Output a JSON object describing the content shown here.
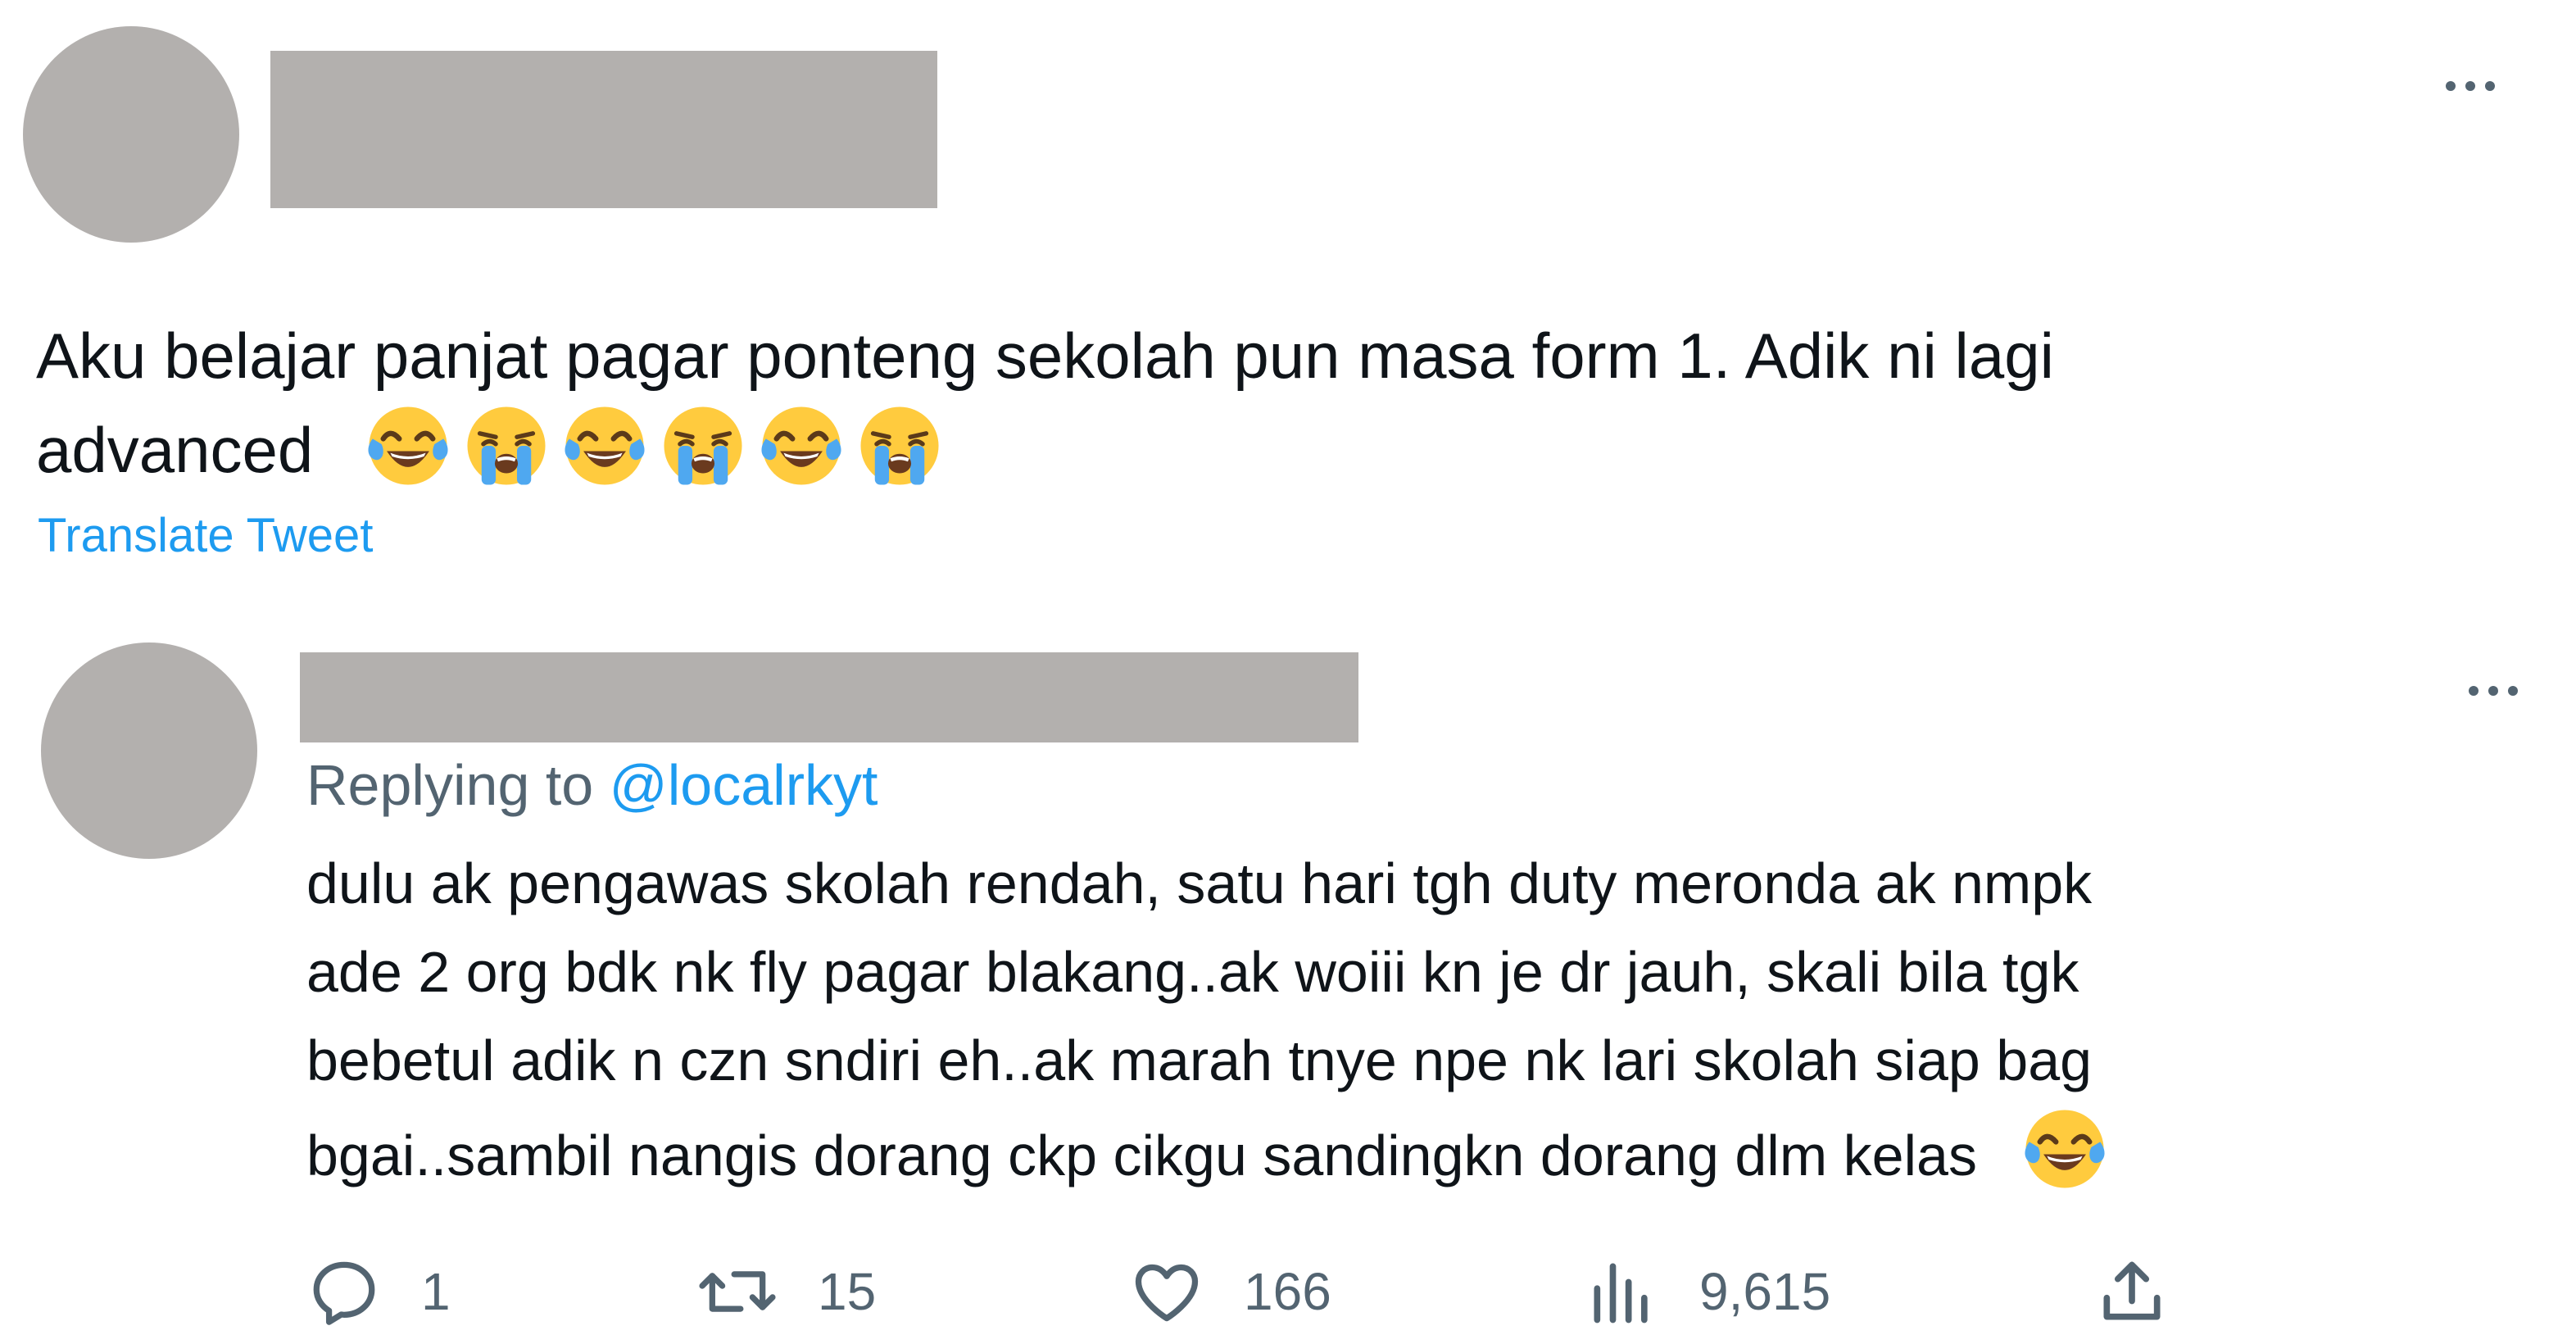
{
  "main_tweet": {
    "text_lines": [
      "Aku belajar panjat pagar ponteng sekolah pun masa form 1. Adik ni lagi",
      "advanced"
    ],
    "emojis": [
      "face-with-tears-of-joy",
      "loudly-crying-face",
      "face-with-tears-of-joy",
      "loudly-crying-face",
      "face-with-tears-of-joy",
      "loudly-crying-face"
    ],
    "translate_label": "Translate Tweet"
  },
  "reply_tweet": {
    "replying_prefix": "Replying to",
    "replying_handle": "@localrkyt",
    "text_lines": [
      "dulu ak pengawas skolah rendah, satu hari tgh duty meronda ak nmpk",
      "ade 2 org bdk nk fly pagar blakang..ak woiii kn je dr jauh, skali bila tgk",
      "bebetul adik n czn sndiri eh..ak marah tnye npe nk lari skolah siap bag",
      "bgai..sambil nangis dorang ckp cikgu sandingkn dorang dlm kelas"
    ],
    "trailing_emoji": "face-with-tears-of-joy",
    "actions": {
      "replies": "1",
      "retweets": "15",
      "likes": "166",
      "views": "9,615"
    }
  },
  "colors": {
    "accent": "#1d9bf0",
    "secondary_text": "#536471",
    "redaction": "#b3b0ae"
  }
}
